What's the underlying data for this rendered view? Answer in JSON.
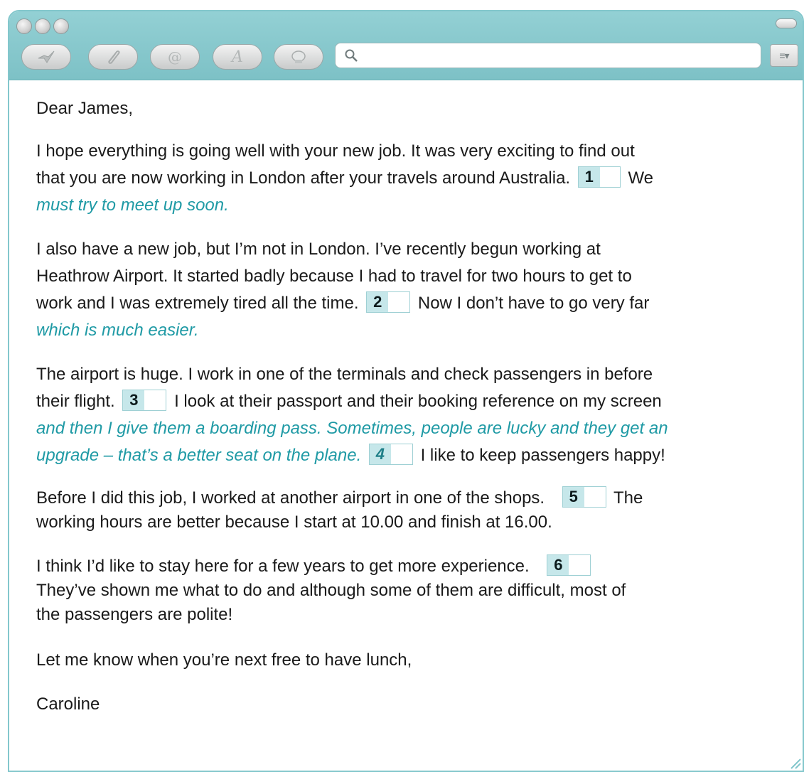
{
  "window": {
    "controls": [
      "close-icon",
      "minimize-icon",
      "zoom-icon"
    ]
  },
  "toolbar": {
    "buttons": [
      {
        "icon": "send-icon"
      },
      {
        "icon": "attach-icon"
      },
      {
        "icon": "address-icon",
        "glyph": "@"
      },
      {
        "icon": "font-icon",
        "glyph": "A"
      },
      {
        "icon": "photo-icon"
      }
    ],
    "search": {
      "placeholder": "",
      "value": ""
    },
    "menu_glyph": "≡▾"
  },
  "email": {
    "greeting": "Dear James,",
    "p1": {
      "a": "I hope everything is going well with your new job. It was very exciting to find out",
      "b": "that you are now working in London after your travels around Australia.",
      "c": "We",
      "d": "must try to meet up soon."
    },
    "p2": {
      "a": "I also have a new job, but I’m not in London. I’ve recently begun working at",
      "b": "Heathrow Airport. It started badly because I had to travel for two hours to get to",
      "c": "work and I was extremely tired all the time.",
      "d": "Now I don’t have to go very far",
      "e": "which is much easier."
    },
    "p3": {
      "a": "The airport is huge. I work in one of the terminals and check passengers in before",
      "b": "their flight.",
      "c": "I look at their passport and their booking reference on my screen",
      "d": "and then I give them a boarding pass. Sometimes, people are lucky and they get an",
      "e": "upgrade – that’s a better seat on the plane.",
      "f": "I like to keep passengers happy!"
    },
    "p4": {
      "a": "Before I did this job, I worked at another airport in one of the shops.",
      "b": "The",
      "c": "working hours are better because I start at 10.00 and finish at 16.00."
    },
    "p5": {
      "a": "I think I’d like to stay here for a few years to get more experience.",
      "b": "They’ve shown me what to do and although some of them are difficult, most of",
      "c": "the passengers are polite!"
    },
    "closing": "Let me know when you’re next free to have lunch,",
    "signature": "Caroline",
    "gaps": [
      "1",
      "2",
      "3",
      "4",
      "5",
      "6"
    ]
  },
  "colors": {
    "chrome": "#83c7cc",
    "teal_text": "#1f9aa5",
    "gap_fill": "#c6e7ea"
  }
}
